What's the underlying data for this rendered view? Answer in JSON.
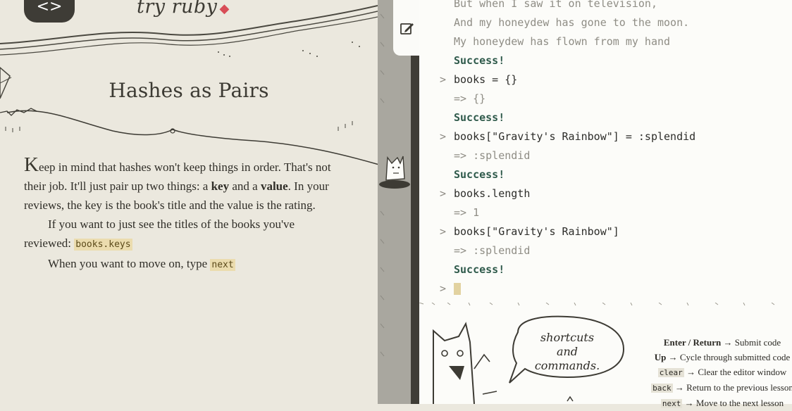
{
  "header": {
    "code_toggle_label": "<>",
    "logo_text": "try ruby"
  },
  "lesson": {
    "title": "Hashes as Pairs",
    "para1": {
      "dropcap": "K",
      "part1": "eep in mind that hashes won't keep things in order. That's not their job. It'll just pair up two things: a ",
      "key_word": "key",
      "part2": " and a ",
      "value_word": "value",
      "part3": ". In your reviews, the key is the book's title and the value is the rating."
    },
    "para2": {
      "text": "If you want to just see the titles of the books you've reviewed: ",
      "code": "books.keys"
    },
    "para3": {
      "text": "When you want to move on, type ",
      "code": "next"
    }
  },
  "console": {
    "lines": [
      {
        "prompt": "",
        "text": "But when I saw it on television,"
      },
      {
        "prompt": "",
        "text": "And my honeydew has gone to the moon."
      },
      {
        "prompt": "",
        "text": "My honeydew has flown from my hand"
      },
      {
        "prompt": "",
        "text": "Success!"
      },
      {
        "prompt": ">",
        "text": "books = {}"
      },
      {
        "prompt": "",
        "text": "=> {}"
      },
      {
        "prompt": "",
        "text": "Success!"
      },
      {
        "prompt": ">",
        "text": "books[\"Gravity's Rainbow\"] = :splendid"
      },
      {
        "prompt": "",
        "text": "=> :splendid"
      },
      {
        "prompt": "",
        "text": "Success!"
      },
      {
        "prompt": ">",
        "text": "books.length"
      },
      {
        "prompt": "",
        "text": "=> 1"
      },
      {
        "prompt": ">",
        "text": "books[\"Gravity's Rainbow\"]"
      },
      {
        "prompt": "",
        "text": "=> :splendid"
      },
      {
        "prompt": "",
        "text": "Success!"
      },
      {
        "prompt": ">",
        "text": ""
      }
    ]
  },
  "help": {
    "bubble_text": "shortcuts and commands.",
    "shortcuts": [
      {
        "key": "Enter / Return",
        "desc": "→ Submit code"
      },
      {
        "key": "Up",
        "desc": "→ Cycle through submitted code"
      },
      {
        "key": "clear",
        "desc": "→ Clear the editor window"
      },
      {
        "key": "back",
        "desc": "→ Return to the previous lesson"
      },
      {
        "key": "next",
        "desc": "→ Move to the next lesson"
      }
    ]
  },
  "colors": {
    "paper": "#ebe8de",
    "console_bg": "#fcfcf9",
    "success": "#2f5a4b",
    "code_highlight": "#ebdcae",
    "ruby_red": "#d84d57"
  }
}
